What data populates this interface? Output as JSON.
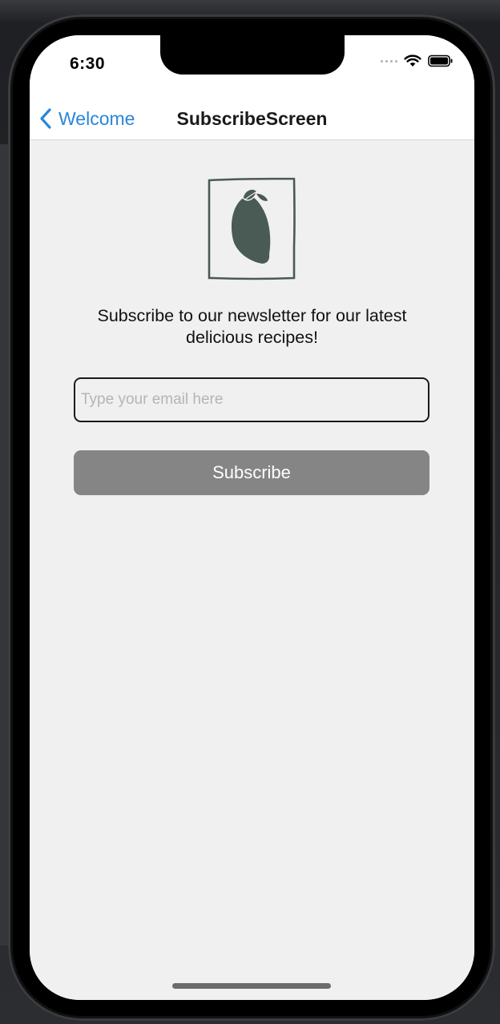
{
  "status_bar": {
    "time": "6:30",
    "icons": [
      "cellular-signal-icon",
      "wifi-icon",
      "battery-icon"
    ]
  },
  "nav": {
    "back_label": "Welcome",
    "title": "SubscribeScreen",
    "back_icon": "chevron-left-icon"
  },
  "main": {
    "logo_icon": "lemon-logo-icon",
    "message": "Subscribe to our newsletter for our latest delicious recipes!",
    "email_placeholder": "Type your email here",
    "email_value": "",
    "subscribe_label": "Subscribe"
  },
  "colors": {
    "accent": "#2b86d9",
    "button_bg": "#858585",
    "logo": "#4a5a54",
    "background": "#f0f0f0"
  }
}
